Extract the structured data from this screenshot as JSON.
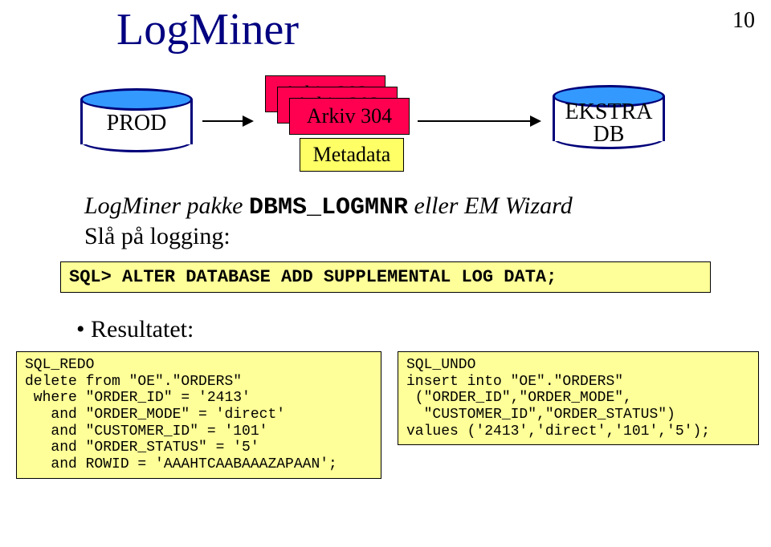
{
  "title": "LogMiner",
  "page_number": "10",
  "db_left": {
    "label": "PROD"
  },
  "db_right_line1": "EKSTRA",
  "db_right_line2": "DB",
  "arkiv_stack": [
    "Arkiv 302",
    "Arkiv 303",
    "Arkiv 304"
  ],
  "metadata_label": "Metadata",
  "narrative_prefix": "LogMiner pakke ",
  "narrative_code": "DBMS_LOGMNR",
  "narrative_suffix": " eller EM Wizard",
  "narrative_line2": "Slå på logging:",
  "sql_alter": "SQL> ALTER DATABASE ADD SUPPLEMENTAL LOG DATA;",
  "result_label": "Resultatet:",
  "sql_redo": "SQL_REDO\ndelete from \"OE\".\"ORDERS\"\n where \"ORDER_ID\" = '2413'\n   and \"ORDER_MODE\" = 'direct'\n   and \"CUSTOMER_ID\" = '101'\n   and \"ORDER_STATUS\" = '5'\n   and ROWID = 'AAAHTCAABAAAZAPAAN';",
  "sql_undo": "SQL_UNDO\ninsert into \"OE\".\"ORDERS\"\n (\"ORDER_ID\",\"ORDER_MODE\",\n  \"CUSTOMER_ID\",\"ORDER_STATUS\")\nvalues ('2413','direct','101','5');"
}
